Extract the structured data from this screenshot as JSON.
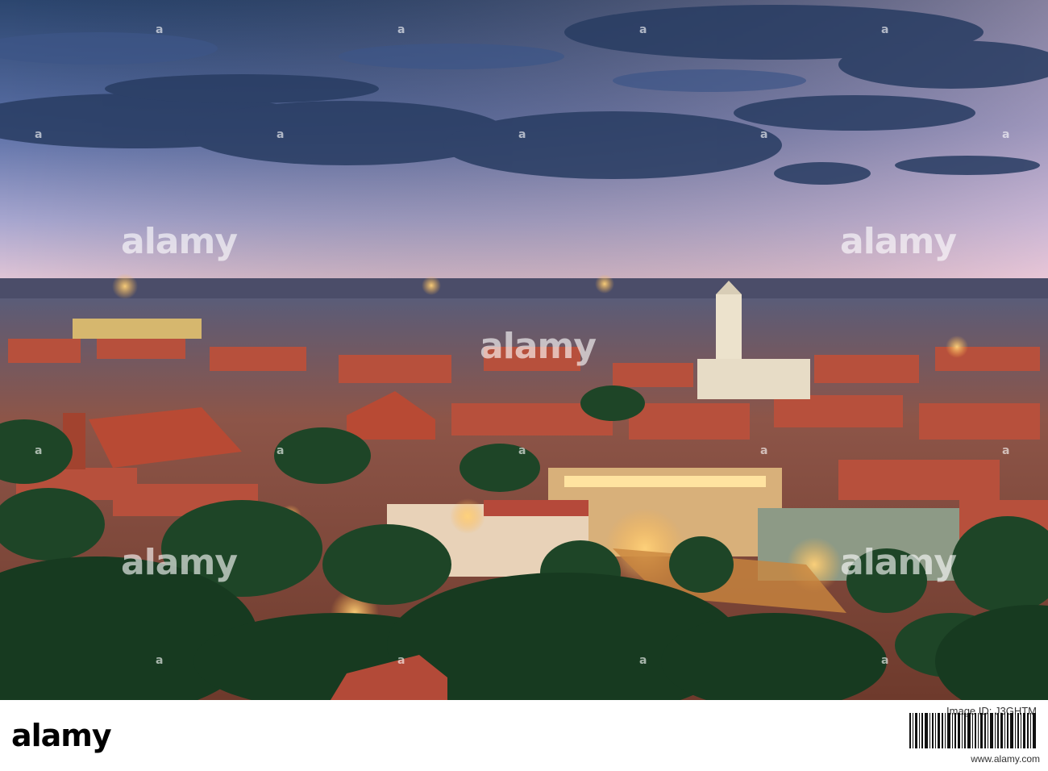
{
  "photo": {
    "scene": "city-at-dusk",
    "colors": {
      "sky_top": "#2f4a78",
      "sky_mid": "#7284b8",
      "sky_horizon": "#d9c3d8",
      "roofs": "#b5493a",
      "trees": "#1f4a2a",
      "lights": "#ffb347"
    }
  },
  "watermark": {
    "brand": "alamy",
    "small_mark": "a"
  },
  "footer": {
    "logo": "alamy",
    "id_label": "Image ID: J3GHTM",
    "id_code": "J3GHTM",
    "url": "www.alamy.com"
  }
}
